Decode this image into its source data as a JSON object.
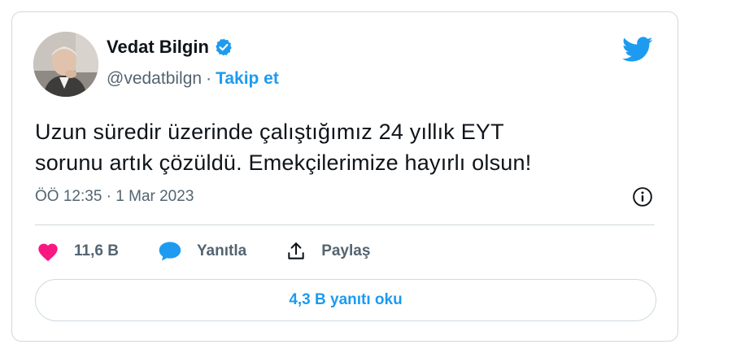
{
  "author": {
    "name": "Vedat Bilgin",
    "handle": "@vedatbilgn",
    "separator": "·",
    "follow_label": "Takip et"
  },
  "tweet": {
    "text": "Uzun süredir üzerinde çalıştığımız 24 yıllık EYT\nsorunu artık çözüldü. Emekçilerimize hayırlı olsun!",
    "timestamp": "ÖÖ 12:35 · 1 Mar 2023"
  },
  "actions": {
    "like_count": "11,6 B",
    "reply_label": "Yanıtla",
    "share_label": "Paylaş"
  },
  "replies_button_label": "4,3 B yanıtı oku",
  "colors": {
    "brand_blue": "#1d9bf0",
    "like_pink": "#f91880",
    "secondary_text": "#536471",
    "border": "#cfd9de"
  },
  "icons": {
    "brand": "twitter-bird-icon",
    "verified": "verified-badge-icon",
    "info": "info-icon",
    "like": "heart-icon",
    "reply": "speech-bubble-icon",
    "share": "share-upload-icon"
  }
}
